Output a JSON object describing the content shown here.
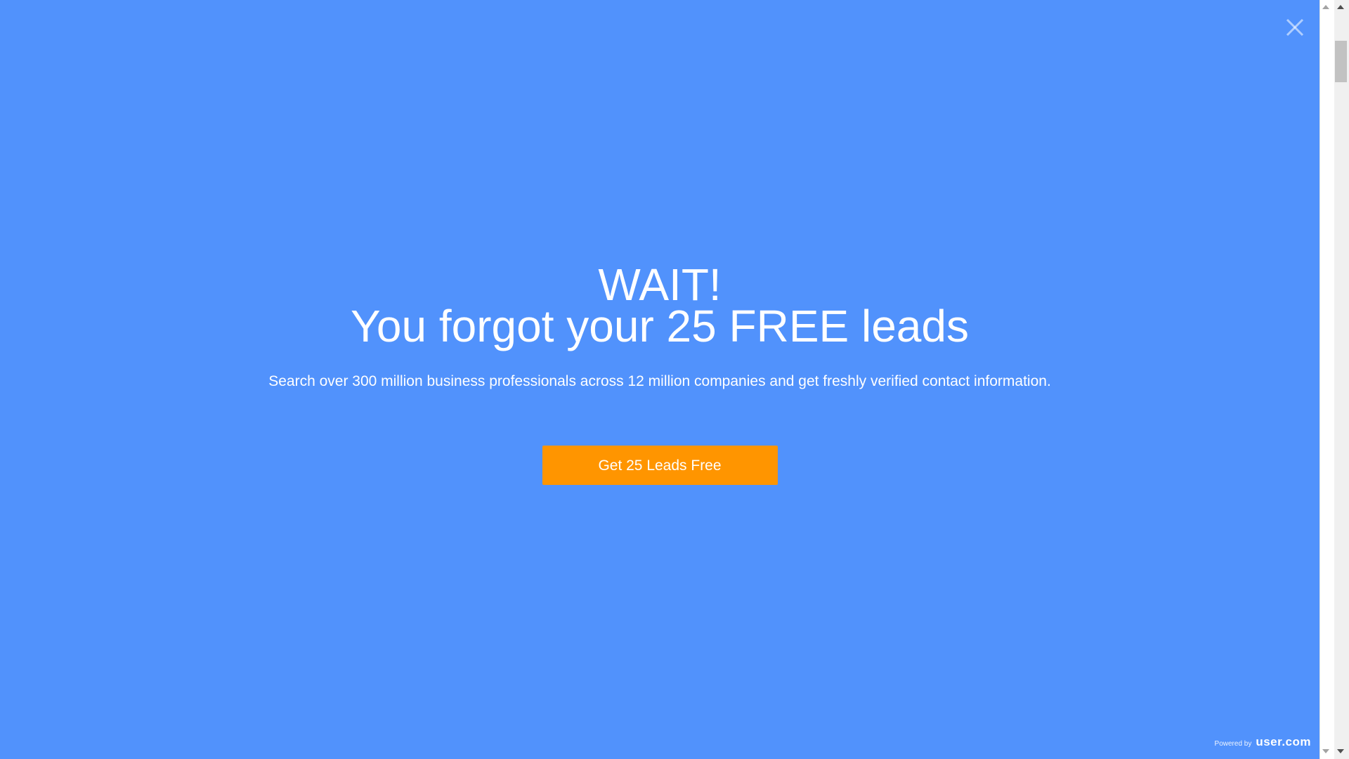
{
  "popup": {
    "headline_line1": "WAIT!",
    "headline_line2": "You forgot your 25 FREE leads",
    "description": "Search over 300 million business professionals across 12 million companies and get freshly verified contact information.",
    "cta_label": "Get 25 Leads Free",
    "powered_by_prefix": "Powered by",
    "powered_by_brand": "user.com"
  },
  "colors": {
    "background": "#5192fc",
    "cta": "#ff9500",
    "text": "#ffffff"
  },
  "icons": {
    "close": "close-icon"
  }
}
